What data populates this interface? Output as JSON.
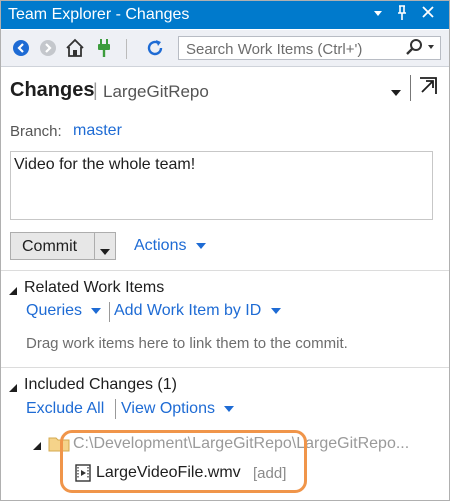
{
  "window": {
    "title": "Team Explorer - Changes"
  },
  "toolbar": {
    "search_placeholder": "Search Work Items (Ctrl+')"
  },
  "header": {
    "title": "Changes",
    "repo": "LargeGitRepo"
  },
  "branch": {
    "label": "Branch:",
    "name": "master"
  },
  "commit_message": "Video for the whole team!",
  "commit": {
    "label": "Commit",
    "actions_label": "Actions"
  },
  "related": {
    "title": "Related Work Items",
    "queries_label": "Queries",
    "add_label": "Add Work Item by ID",
    "hint": "Drag work items here to link them to the commit."
  },
  "included": {
    "title": "Included Changes (1)",
    "exclude_all_label": "Exclude All",
    "view_options_label": "View Options",
    "folder_path": "C:\\Development\\LargeGitRepo\\LargeGitRepo...",
    "file_name": "LargeVideoFile.wmv",
    "file_status": "[add]"
  },
  "colors": {
    "title_bar": "#007acc",
    "link": "#1e6bd4",
    "highlight": "#f0954a"
  }
}
